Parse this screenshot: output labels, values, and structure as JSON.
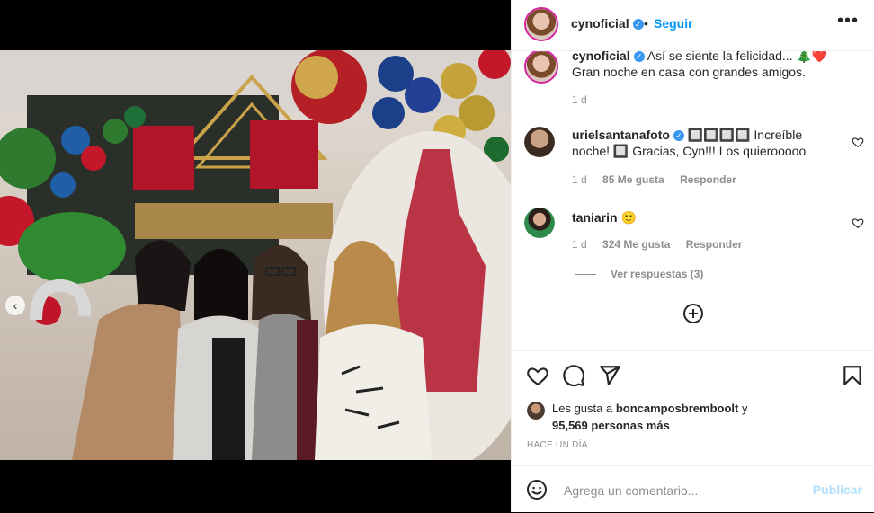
{
  "post": {
    "author": "cynoficial",
    "follow_label": "Seguir",
    "separator": "•",
    "more_label": "•••"
  },
  "caption": {
    "author": "cynoficial",
    "text": "Así se siente la felicidad... 🎄❤️ Gran noche en casa con grandes amigos.",
    "time": "1 d"
  },
  "comments": [
    {
      "author": "urielsantanafoto",
      "text": "🔲🔲🔲🔲 Increíble noche! 🔲 Gracias, Cyn!!! Los quierooooo",
      "time": "1 d",
      "likes": "85 Me gusta",
      "reply_label": "Responder"
    },
    {
      "author": "taniarin",
      "text": "🙂",
      "time": "1 d",
      "likes": "324 Me gusta",
      "reply_label": "Responder",
      "view_replies": "Ver respuestas (3)"
    }
  ],
  "likes": {
    "prefix": "Les gusta a",
    "user": "boncamposbremboolt",
    "connector": "y",
    "others": "95,569 personas más"
  },
  "timestamp": "HACE UN DÍA",
  "comment_box": {
    "placeholder": "Agrega un comentario...",
    "publish_label": "Publicar"
  },
  "icons": {
    "heart": "heart-icon",
    "comment": "comment-icon",
    "share": "share-icon",
    "save": "bookmark-icon",
    "emoji": "emoji-icon",
    "add": "plus-circle-icon"
  },
  "colors": {
    "link_blue": "#0095f6",
    "verified_blue": "#3897f0",
    "muted": "#8e8e8e",
    "publish_disabled": "#b2dffc"
  }
}
